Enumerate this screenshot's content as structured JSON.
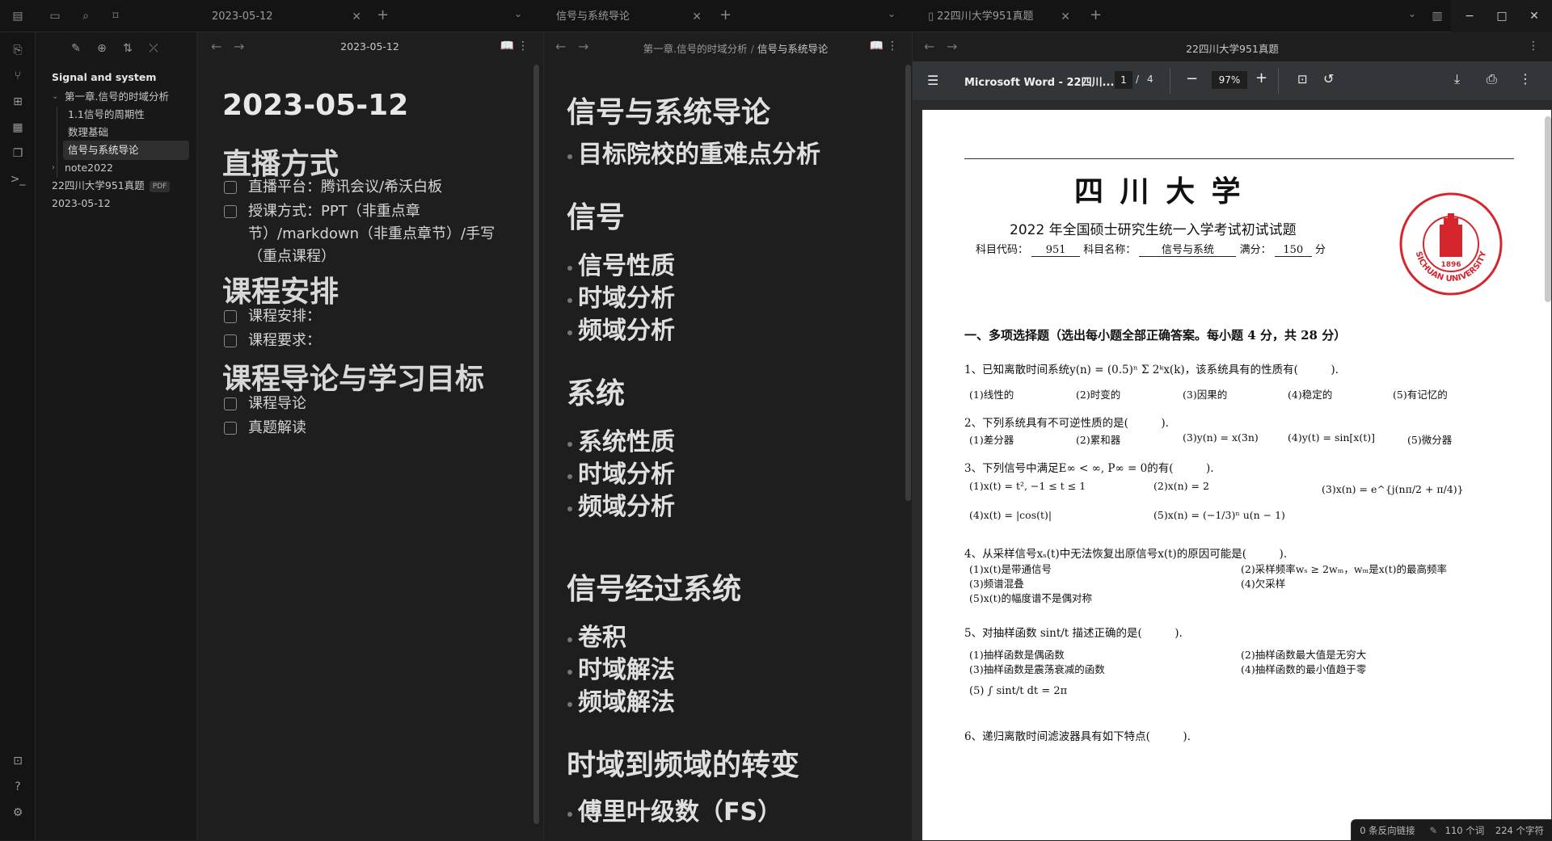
{
  "titlebar": {
    "tab1": "2023-05-12",
    "tab2": "信号与系统导论",
    "tab3": "22四川大学951真题",
    "minimize": "−",
    "maximize": "□",
    "close": "✕"
  },
  "sidebar": {
    "vault": "Signal and system",
    "items": [
      "第一章.信号的时域分析",
      "1.1信号的周期性",
      "数理基础",
      "信号与系统导论",
      "note2022",
      "22四川大学951真题",
      "2023-05-12"
    ],
    "pdf_badge": "PDF"
  },
  "pane1": {
    "title": "2023-05-12",
    "heading": "2023-05-12",
    "sections": [
      {
        "title": "直播方式",
        "tasks": [
          "直播平台：腾讯会议/希沃白板",
          "授课方式：PPT（非重点章节）/markdown（非重点章节）/手写（重点课程）"
        ]
      },
      {
        "title": "课程安排",
        "tasks": [
          "课程安排：",
          "课程要求："
        ]
      },
      {
        "title": "课程导论与学习目标",
        "tasks": [
          "课程导论",
          "真题解读"
        ]
      }
    ]
  },
  "pane2": {
    "breadcrumb_parent": "第一章.信号的时域分析",
    "breadcrumb_sep": "/",
    "breadcrumb_current": "信号与系统导论",
    "heading": "信号与系统导论",
    "intro": "目标院校的重难点分析",
    "sections": [
      {
        "title": "信号",
        "bullets": [
          "信号性质",
          "时域分析",
          "频域分析"
        ]
      },
      {
        "title": "系统",
        "bullets": [
          "系统性质",
          "时域分析",
          "频域分析"
        ]
      },
      {
        "title": "信号经过系统",
        "bullets": [
          "卷积",
          "时域解法",
          "频域解法"
        ]
      },
      {
        "title": "时域到频域的转变",
        "bullets": [
          "傅里叶级数（FS）"
        ]
      }
    ]
  },
  "pane3": {
    "title": "22四川大学951真题",
    "toolbar": {
      "doc_title": "Microsoft Word - 22四川...",
      "page_current": "1",
      "page_sep": "/",
      "page_total": "4",
      "zoom": "97%"
    },
    "pdf": {
      "university": "四 川 大 学",
      "exam_title": "2022 年全国硕士研究生统一入学考试初试试题",
      "subject_code_label": "科目代码：",
      "subject_code": "951",
      "subject_name_label": "科目名称：",
      "subject_name": "信号与系统",
      "score_label": "满分：",
      "score": "150",
      "score_unit": "分",
      "seal_year": "1896",
      "seal_text": "SICHUAN UNIVERSITY",
      "section1": "一、多项选择题（选出每小题全部正确答案。每小题 4 分，共 28 分）",
      "q1": "1、已知离散时间系统y(n) = (0.5)ⁿ Σ 2ᵏx(k)，该系统具有的性质有(　　　).",
      "q1_opts": [
        "(1)线性的",
        "(2)时变的",
        "(3)因果的",
        "(4)稳定的",
        "(5)有记忆的"
      ],
      "q2": "2、下列系统具有不可逆性质的是(　　　).",
      "q2_opts": [
        "(1)差分器",
        "(2)累和器",
        "(3)y(n) = x(3n)",
        "(4)y(t) = sin[x(t)]",
        "(5)微分器"
      ],
      "q3": "3、下列信号中满足E∞ < ∞, P∞ = 0的有(　　　).",
      "q3_opts": [
        "(1)x(t) = t², −1 ≤ t ≤ 1",
        "(2)x(n) = 2",
        "(3)x(n) = e^{j(nπ/2 + π/4)}",
        "(4)x(t) = |cos(t)|",
        "(5)x(n) = (−1/3)ⁿ u(n − 1)"
      ],
      "q4": "4、从采样信号xₛ(t)中无法恢复出原信号x(t)的原因可能是(　　　).",
      "q4_opts": [
        "(1)x(t)是带通信号",
        "(2)采样频率wₛ ≥ 2wₘ，wₘ是x(t)的最高频率",
        "(3)频谱混叠",
        "(4)欠采样",
        "(5)x(t)的幅度谱不是偶对称"
      ],
      "q5": "5、对抽样函数 sint/t 描述正确的是(　　　).",
      "q5_opts": [
        "(1)抽样函数是偶函数",
        "(2)抽样函数最大值是无穷大",
        "(3)抽样函数是震荡衰减的函数",
        "(4)抽样函数的最小值趋于零",
        "(5) ∫ sint/t dt = 2π"
      ],
      "q6": "6、递归离散时间滤波器具有如下特点(　　　)."
    },
    "status": {
      "backlinks": "0 条反向链接",
      "words": "110 个词",
      "chars": "224 个字符"
    }
  }
}
